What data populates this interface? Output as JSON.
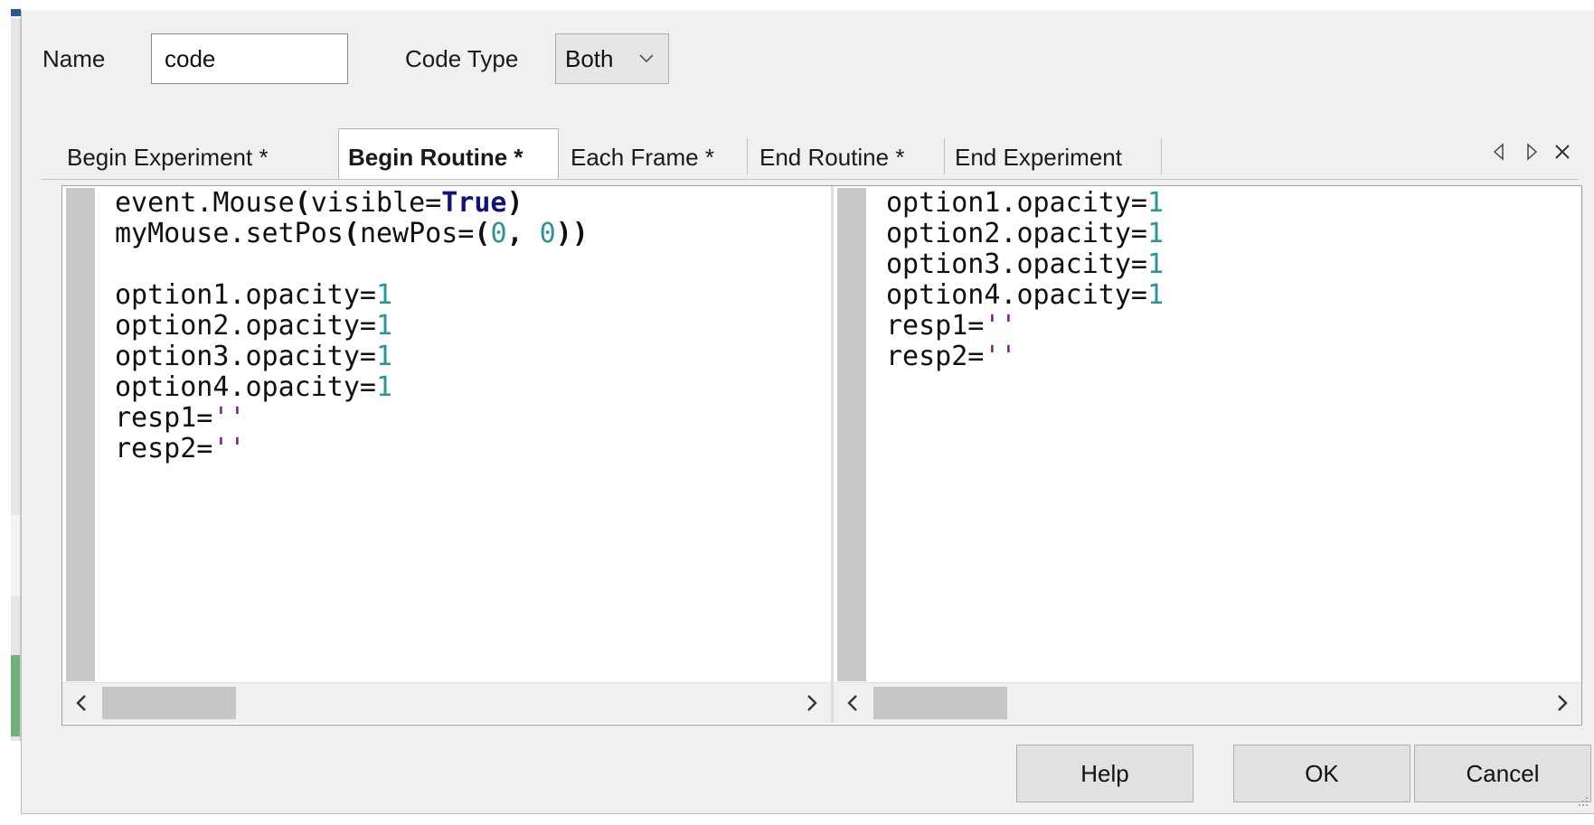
{
  "form": {
    "name_label": "Name",
    "name_value": "code",
    "code_type_label": "Code Type",
    "code_type_value": "Both"
  },
  "tabs": [
    {
      "label": "Begin Experiment *",
      "active": false
    },
    {
      "label": "Begin Routine *",
      "active": true
    },
    {
      "label": "Each Frame *",
      "active": false
    },
    {
      "label": "End Routine *",
      "active": false
    },
    {
      "label": "End Experiment",
      "active": false
    }
  ],
  "tab_controls": {
    "prev_icon": "triangle-left-icon",
    "next_icon": "triangle-right-icon",
    "close_icon": "close-icon"
  },
  "editors": {
    "left": {
      "lines": [
        [
          {
            "t": "event.Mouse"
          },
          {
            "t": "(",
            "c": "op"
          },
          {
            "t": "visible="
          },
          {
            "t": "True",
            "c": "kw"
          },
          {
            "t": ")",
            "c": "op"
          }
        ],
        [
          {
            "t": "myMouse.setPos"
          },
          {
            "t": "(",
            "c": "op"
          },
          {
            "t": "newPos="
          },
          {
            "t": "(",
            "c": "op"
          },
          {
            "t": "0",
            "c": "num"
          },
          {
            "t": ", ",
            "c": "op"
          },
          {
            "t": "0",
            "c": "num"
          },
          {
            "t": "))",
            "c": "op"
          }
        ],
        [],
        [
          {
            "t": "option1.opacity="
          },
          {
            "t": "1",
            "c": "num"
          }
        ],
        [
          {
            "t": "option2.opacity="
          },
          {
            "t": "1",
            "c": "num"
          }
        ],
        [
          {
            "t": "option3.opacity="
          },
          {
            "t": "1",
            "c": "num"
          }
        ],
        [
          {
            "t": "option4.opacity="
          },
          {
            "t": "1",
            "c": "num"
          }
        ],
        [
          {
            "t": "resp1="
          },
          {
            "t": "''",
            "c": "str"
          }
        ],
        [
          {
            "t": "resp2="
          },
          {
            "t": "''",
            "c": "str"
          }
        ]
      ]
    },
    "right": {
      "lines": [
        [
          {
            "t": "option1.opacity="
          },
          {
            "t": "1",
            "c": "num"
          }
        ],
        [
          {
            "t": "option2.opacity="
          },
          {
            "t": "1",
            "c": "num"
          }
        ],
        [
          {
            "t": "option3.opacity="
          },
          {
            "t": "1",
            "c": "num"
          }
        ],
        [
          {
            "t": "option4.opacity="
          },
          {
            "t": "1",
            "c": "num"
          }
        ],
        [
          {
            "t": "resp1="
          },
          {
            "t": "''",
            "c": "str"
          }
        ],
        [
          {
            "t": "resp2="
          },
          {
            "t": "''",
            "c": "str"
          }
        ]
      ]
    }
  },
  "scroll": {
    "left_icon": "chevron-left-icon",
    "right_icon": "chevron-right-icon"
  },
  "buttons": {
    "help": "Help",
    "ok": "OK",
    "cancel": "Cancel"
  },
  "colors": {
    "number": "#2b9496",
    "keyword": "#111180",
    "string": "#7f1f88",
    "dialog_bg": "#f0f0f0"
  }
}
